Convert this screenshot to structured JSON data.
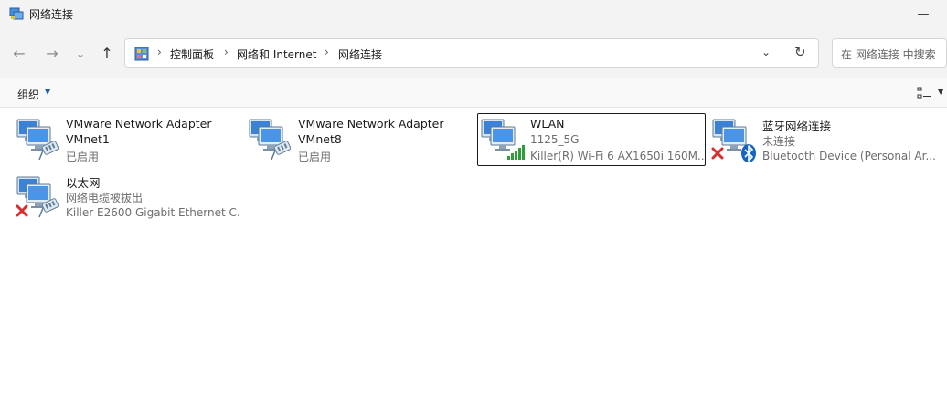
{
  "window": {
    "title": "网络连接"
  },
  "address_bar": {
    "breadcrumbs": [
      "控制面板",
      "网络和 Internet",
      "网络连接"
    ],
    "separator": "›"
  },
  "search": {
    "placeholder": "在 网络连接 中搜索"
  },
  "toolbar": {
    "organize_label": "组织"
  },
  "connections": [
    {
      "name": "VMware Network Adapter VMnet1",
      "line1": "VMware Network Adapter",
      "line2": "VMnet1",
      "line3": "已启用",
      "overlay": "cable",
      "selected": false
    },
    {
      "name": "VMware Network Adapter VMnet8",
      "line1": "VMware Network Adapter",
      "line2": "VMnet8",
      "line3": "已启用",
      "overlay": "cable",
      "selected": false
    },
    {
      "name": "WLAN",
      "line1": "WLAN",
      "line2": "1125_5G",
      "line3": "Killer(R) Wi-Fi 6 AX1650i 160M...",
      "overlay": "wifi-signal",
      "selected": true
    },
    {
      "name": "蓝牙网络连接",
      "line1": "蓝牙网络连接",
      "line2": "未连接",
      "line3": "Bluetooth Device (Personal Ar...",
      "overlay": "bluetooth-disconnected",
      "selected": false
    },
    {
      "name": "以太网",
      "line1": "以太网",
      "line2": "网络电缆被拔出",
      "line3": "Killer E2600 Gigabit Ethernet C...",
      "overlay": "cable-disconnected",
      "selected": false
    }
  ],
  "colors": {
    "accent": "#1a5fb4",
    "error": "#d32f2f",
    "signal": "#2e9d3a",
    "bluetooth": "#1565c0"
  }
}
